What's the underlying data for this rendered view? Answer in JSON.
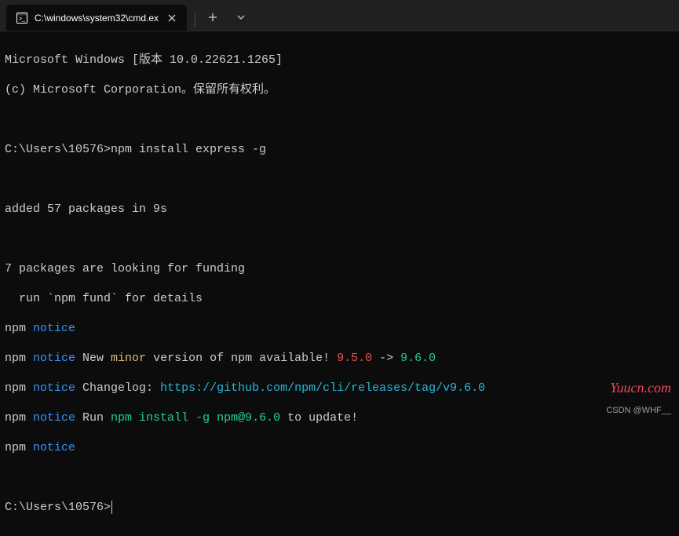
{
  "tab": {
    "title": "C:\\windows\\system32\\cmd.ex",
    "icon_name": "cmd-icon"
  },
  "terminal": {
    "line1": "Microsoft Windows [版本 10.0.22621.1265]",
    "line2": "(c) Microsoft Corporation。保留所有权利。",
    "prompt1_path": "C:\\Users\\10576>",
    "prompt1_cmd": "npm install express -g",
    "added": "added 57 packages in 9s",
    "funding1": "7 packages are looking for funding",
    "funding2": "  run `npm fund` for details",
    "npm_label": "npm ",
    "notice_label": "notice",
    "notice_new_pre": " New ",
    "notice_minor": "minor",
    "notice_new_post": " version of npm available! ",
    "notice_old_ver": "9.5.0",
    "notice_arrow": " -> ",
    "notice_new_ver": "9.6.0",
    "notice_changelog_pre": " Changelog: ",
    "notice_changelog_url": "https://github.com/npm/cli/releases/tag/v9.6.0",
    "notice_run_pre": " Run ",
    "notice_run_cmd": "npm install -g npm@9.6.0",
    "notice_run_post": " to update!",
    "prompt2_path": "C:\\Users\\10576>"
  },
  "watermark": "Yuucn.com",
  "attribution": "CSDN @WHF__"
}
